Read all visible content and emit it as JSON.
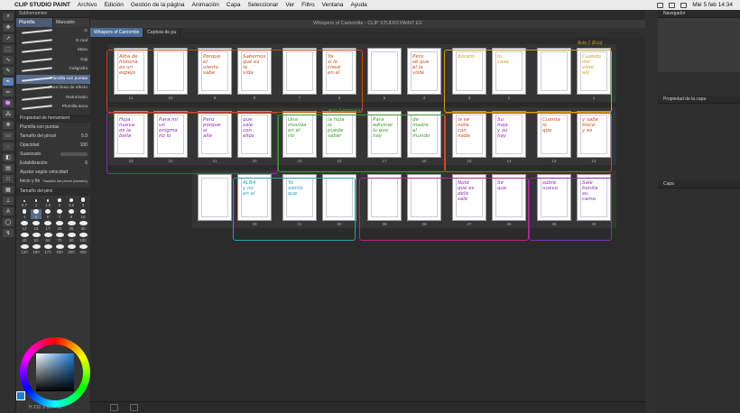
{
  "menubar": {
    "app": "CLIP STUDIO PAINT",
    "items": [
      "Archivo",
      "Edición",
      "Gestión de la página",
      "Animación",
      "Capa",
      "Seleccionar",
      "Ver",
      "Filtro",
      "Ventana",
      "Ayuda"
    ],
    "clock": "Mié 5 feb 14:34"
  },
  "window_title": "Whispers of Camomile - CLIP STUDIO PAINT EX",
  "doc_tabs": [
    "Whispers of Camomile",
    "Captura de pa"
  ],
  "subtool": {
    "header": "Subherramien",
    "tabs": [
      "Plumilla",
      "Marcador"
    ],
    "brushes": [
      "G",
      "G real",
      "Maru",
      "Saji",
      "Caligrafía",
      "Plumilla con puntas",
      "Para línea de efecto",
      "Texturizado",
      "Plumilla seca"
    ],
    "selected": "Plumilla con puntas"
  },
  "tool_property": {
    "header": "Propiedad de herramient",
    "tool_name": "Plumilla con puntas",
    "brush_size_label": "Tamaño del pincel",
    "brush_size_value": "5.0",
    "opacity_label": "Opacidad",
    "opacity_value": "100",
    "smoothing_label": "Suavizado",
    "stabilization_label": "Estabilización",
    "stabilization_value": "6",
    "speed_label": "Ajustar según velocidad",
    "start_end_label": "Inicio y fin",
    "start_end_value": "Tamaño del pincel (tamaño)"
  },
  "brush_size_panel": {
    "header": "Tamaño del pinc",
    "sizes": [
      "0.7",
      "1",
      "1.5",
      "2",
      "2.5",
      "3",
      "4",
      "5",
      "6",
      "7",
      "8",
      "10",
      "12",
      "15",
      "17",
      "20",
      "25",
      "30",
      "40",
      "50",
      "60",
      "70",
      "80",
      "100",
      "120",
      "150",
      "170",
      "200",
      "250",
      "300"
    ]
  },
  "color": {
    "values": "H 210  S 81  V 92",
    "accent": "#1c7dd6"
  },
  "right_panel": {
    "navigator": "Navegador",
    "layer_property": "Propiedad de la capa",
    "layer": "Capa"
  },
  "notes": {
    "acto1": "Acto 1 (Eco)",
    "acto2": "Acto 2 (mariana)"
  },
  "spreads": [
    {
      "pages": [
        {
          "num": "11",
          "ink": "Alba de\nhistoria\nes un\nespejo",
          "color": "#c94a1a"
        },
        {
          "num": "10",
          "ink": "",
          "color": "#c94a1a"
        }
      ]
    },
    {
      "pages": [
        {
          "num": "9",
          "ink": "Porque\nel\nviento\nsabe",
          "color": "#c94a1a"
        },
        {
          "num": "0",
          "ink": "Sabemos\nqué es\nla\nvida",
          "color": "#c94a1a"
        }
      ]
    },
    {
      "pages": [
        {
          "num": "7",
          "ink": "",
          "color": "#c94a1a"
        },
        {
          "num": "6",
          "ink": "Ya\nsi lo\nclavé\nen el",
          "color": "#c94a1a"
        }
      ]
    },
    {
      "pages": [
        {
          "num": "5",
          "ink": "",
          "color": "#c94a1a"
        },
        {
          "num": "4",
          "ink": "Pero\nsé que\nel la\nviste",
          "color": "#c94a1a"
        }
      ]
    },
    {
      "pages": [
        {
          "num": "3",
          "ink": "boceto",
          "color": "#c9a21a"
        },
        {
          "num": "2",
          "ink": "tu\ncasa",
          "color": "#c9a21a"
        }
      ]
    },
    {
      "pages": [
        {
          "num": "",
          "ink": "",
          "color": "#c9a21a"
        },
        {
          "num": "1",
          "ink": "Cuando\nme\nvisto\nallí",
          "color": "#c9a21a"
        }
      ]
    },
    {
      "pages": [
        {
          "num": "23",
          "ink": "Hoja\nnueva\nes la\nbella",
          "color": "#8a2ab0"
        },
        {
          "num": "22",
          "ink": "Para mí\nun\nenigma\nno lo",
          "color": "#8a2ab0"
        }
      ]
    },
    {
      "pages": [
        {
          "num": "21",
          "ink": "Pero\nporque\nsi\nalla",
          "color": "#8a2ab0"
        },
        {
          "num": "20",
          "ink": "que\nsale\ncon\nellos",
          "color": "#8a2ab0"
        }
      ]
    },
    {
      "pages": [
        {
          "num": "19",
          "ink": "Una\nmovida\nen el\nrío",
          "color": "#3a9a2a"
        },
        {
          "num": "18",
          "ink": "la hoja\nlo\npuede\nsaber",
          "color": "#3a9a2a"
        }
      ]
    },
    {
      "pages": [
        {
          "num": "17",
          "ink": "Para\nadivinar\nlo que\nhay",
          "color": "#3a9a2a"
        },
        {
          "num": "16",
          "ink": "de\nmadre\nel\nmundo",
          "color": "#3a9a2a"
        }
      ]
    },
    {
      "pages": [
        {
          "num": "15",
          "ink": "la ve\nnota\ncon\nnada",
          "color": "#c94a1a"
        },
        {
          "num": "14",
          "ink": "Su\nhoja\ny su\nhay",
          "color": "#8a2ab0"
        }
      ]
    },
    {
      "pages": [
        {
          "num": "13",
          "ink": "Cuenta\nlo\nque",
          "color": "#c94a1a"
        },
        {
          "num": "12",
          "ink": "y sabe\nbisco\ny es",
          "color": "#c94a1a"
        }
      ]
    },
    {
      "pages": [
        {
          "num": "",
          "ink": "",
          "color": "#2aa0b0"
        },
        {
          "num": "33",
          "ink": "ALBA\ny no\nen el",
          "color": "#2aa0b0"
        }
      ]
    },
    {
      "pages": [
        {
          "num": "31",
          "ink": "Yo\nsiento\nque",
          "color": "#2aa0b0"
        },
        {
          "num": "30",
          "ink": "",
          "color": "#2aa0b0"
        }
      ]
    },
    {
      "pages": [
        {
          "num": "29",
          "ink": "",
          "color": "#b02a8a"
        },
        {
          "num": "28",
          "ink": "",
          "color": "#b02a8a"
        }
      ]
    },
    {
      "pages": [
        {
          "num": "27",
          "ink": "Noté\nque es\ndelic\nsale",
          "color": "#8a2ab0"
        },
        {
          "num": "26",
          "ink": "Sé\nque",
          "color": "#8a2ab0"
        }
      ]
    },
    {
      "pages": [
        {
          "num": "25",
          "ink": "sobre\nnuevo",
          "color": "#8a2ab0"
        },
        {
          "num": "24",
          "ink": "Sale\nbonita\nsu\ncamo",
          "color": "#8a2ab0"
        }
      ]
    }
  ]
}
